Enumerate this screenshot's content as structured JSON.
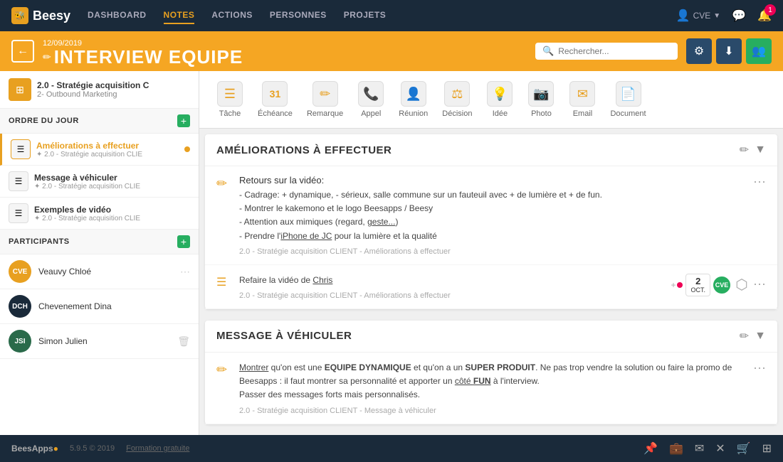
{
  "nav": {
    "logo": "Beesy",
    "links": [
      "DASHBOARD",
      "NOTES",
      "ACTIONS",
      "PERSONNES",
      "PROJETS"
    ],
    "active_link": "NOTES",
    "user": "CVE",
    "notification_count": "1"
  },
  "header": {
    "date": "12/09/2019",
    "title": "INTERVIEW EQUIPE",
    "search_placeholder": "Rechercher...",
    "btn_filter": "⚙",
    "btn_download": "⬇",
    "btn_people": "👥"
  },
  "sidebar": {
    "project_name": "2.0 - Stratégie acquisition C",
    "project_sub": "2- Outbound Marketing",
    "ordre_du_jour": "ORDRE DU JOUR",
    "agenda_items": [
      {
        "name": "Améliorations à effectuer",
        "sub": "✦ 2.0 - Stratégie acquisition CLIE",
        "active": true,
        "dot": true
      },
      {
        "name": "Message à véhiculer",
        "sub": "✦ 2.0 - Stratégie acquisition CLIE",
        "active": false,
        "dot": false
      },
      {
        "name": "Exemples de vidéo",
        "sub": "✦ 2.0 - Stratégie acquisition CLIE",
        "active": false,
        "dot": false
      }
    ],
    "participants_label": "PARTICIPANTS",
    "participants": [
      {
        "initials": "CVE",
        "name": "Veauvy Chloé",
        "bg": "#e8a020"
      },
      {
        "initials": "DCH",
        "name": "Chevenement Dina",
        "bg": "#1a2a3a"
      },
      {
        "initials": "JSI",
        "name": "Simon Julien",
        "bg": "#2a6a4a"
      }
    ]
  },
  "toolbar": {
    "items": [
      {
        "icon": "☰",
        "label": "Tâche"
      },
      {
        "icon": "31",
        "label": "Échéance"
      },
      {
        "icon": "✏",
        "label": "Remarque"
      },
      {
        "icon": "📞",
        "label": "Appel"
      },
      {
        "icon": "👤",
        "label": "Réunion"
      },
      {
        "icon": "⚖",
        "label": "Décision"
      },
      {
        "icon": "💡",
        "label": "Idée"
      },
      {
        "icon": "📷",
        "label": "Photo"
      },
      {
        "icon": "✉",
        "label": "Email"
      },
      {
        "icon": "📄",
        "label": "Document"
      }
    ]
  },
  "notes": {
    "sections": [
      {
        "title": "AMÉLIORATIONS À EFFECTUER",
        "entries": [
          {
            "icon": "✏",
            "type": "remark",
            "content": "Retours sur la vidéo:\n\n- Cadrage: + dynamique, - sérieux, salle commune sur un fauteuil avec + de lumière et + de fun.\n- Montrer le kakemono et le logo Beesapps / Beesy\n- Attention aux mimiques (regard, geste...)\n- Prendre l'iPhone de JC pour la lumière et la qualité",
            "project_tag": "2.0 - Stratégie acquisition CLIENT - Améliorations à effectuer",
            "has_meta": false
          },
          {
            "icon": "☰",
            "type": "task",
            "content": "Refaire la vidéo de Chris",
            "project_tag": "2.0 - Stratégie acquisition CLIENT - Améliorations à effectuer",
            "has_meta": true,
            "meta_date_num": "2",
            "meta_date_month": "OCT.",
            "meta_user": "CVE"
          }
        ]
      },
      {
        "title": "MESSAGE À VÉHICULER",
        "entries": [
          {
            "icon": "✏",
            "type": "remark",
            "content": "Montrer qu'on est une EQUIPE DYNAMIQUE et qu'on a un SUPER PRODUIT. Ne pas trop vendre la solution ou faire la promo de Beesapps : il faut montrer sa personnalité et apporter un côté FUN à l'interview.\nPasser des messages forts mais personnalisés.",
            "project_tag": "2.0 - Stratégie acquisition CLIENT - Message à véhiculer",
            "has_meta": false
          }
        ]
      }
    ]
  },
  "bottom_bar": {
    "logo": "BeesApps",
    "version": "5.9.5 © 2019",
    "link": "Formation gratuite"
  }
}
